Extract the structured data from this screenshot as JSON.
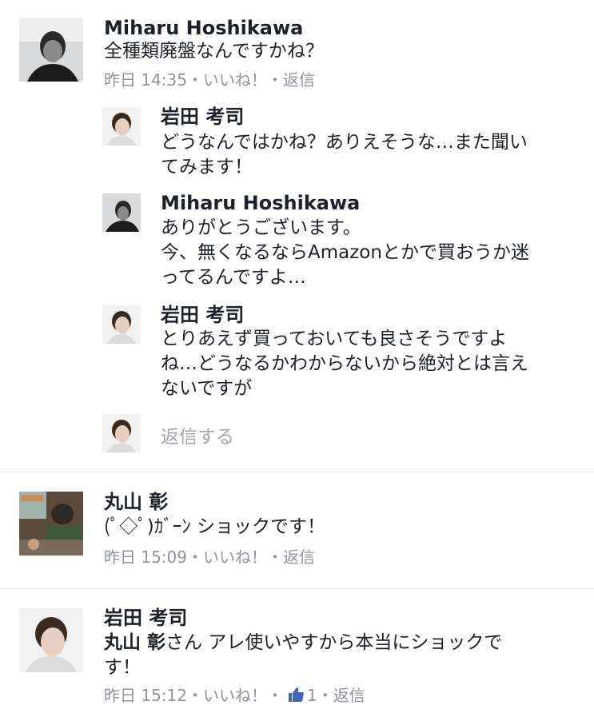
{
  "comments": [
    {
      "author": "Miharu Hoshikawa",
      "text": "全種類廃盤なんですかね？",
      "time": "昨日 14:35",
      "like": "いいね！",
      "reply": "返信"
    },
    {
      "author": "丸山 彰",
      "text": "(ﾟ◇ﾟ)ｶﾞｰﾝ ショックです！",
      "time": "昨日 15:09",
      "like": "いいね！",
      "reply": "返信"
    },
    {
      "author": "岩田 考司",
      "mention": "丸山 彰",
      "text_after_mention": "さん アレ使いやすから本当にショックで",
      "text_line2": "す！",
      "time": "昨日 15:12",
      "like": "いいね！",
      "like_count": "1",
      "reply": "返信"
    }
  ],
  "replies": [
    {
      "author": "岩田 考司",
      "lines": [
        "どうなんではかね？ありえそうな…また聞い",
        "てみます！"
      ]
    },
    {
      "author": "Miharu Hoshikawa",
      "lines": [
        "ありがとうございます。",
        "今、無くなるならAmazonとかで買おうか迷",
        "ってるんですよ…"
      ]
    },
    {
      "author": "岩田 考司",
      "lines": [
        "とりあえず買っておいても良さそうですよ",
        "ね…どうなるかわからないから絶対とは言え",
        "ないですが"
      ]
    }
  ],
  "reply_input_placeholder": "返信する",
  "separator": "・",
  "colors": {
    "meta": "#90949c",
    "text": "#1d2129",
    "divider": "#dddfe2",
    "like_blue": "#4267b2"
  }
}
